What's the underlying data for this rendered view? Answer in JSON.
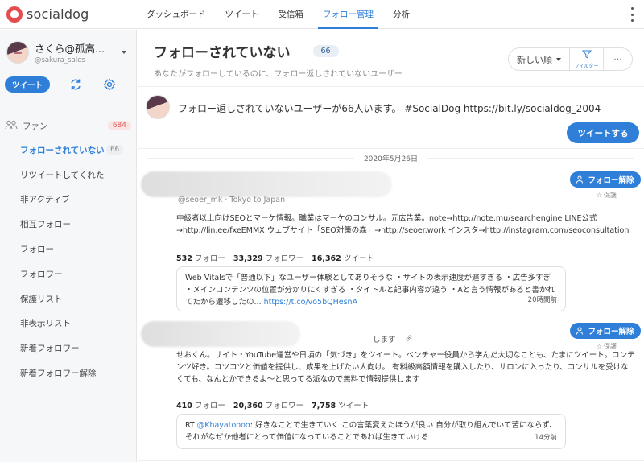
{
  "app": {
    "logo_text": "socialdog"
  },
  "nav": {
    "items": [
      {
        "label": "ダッシュボード"
      },
      {
        "label": "ツイート"
      },
      {
        "label": "受信箱"
      },
      {
        "label": "フォロー管理"
      },
      {
        "label": "分析"
      }
    ],
    "active": "フォロー管理"
  },
  "account": {
    "name": "さくら@孤高...",
    "handle": "@sakura_sales"
  },
  "sidebar": {
    "tweet_button": "ツイート",
    "fan": {
      "label": "ファン",
      "count": "684"
    },
    "items": [
      {
        "label": "フォローされていない",
        "count": "66"
      },
      {
        "label": "リツイートしてくれた"
      },
      {
        "label": "非アクティブ"
      },
      {
        "label": "相互フォロー"
      },
      {
        "label": "フォロー"
      },
      {
        "label": "フォロワー"
      },
      {
        "label": "保護リスト"
      },
      {
        "label": "非表示リスト"
      },
      {
        "label": "新着フォロワー"
      },
      {
        "label": "新着フォロワー解除"
      }
    ]
  },
  "header": {
    "title": "フォローされていない",
    "count": "66",
    "subtitle": "あなたがフォローしているのに、フォロー返しされていないユーザー",
    "sort_label": "新しい順",
    "filter_label": "フィルター",
    "more_label": "···"
  },
  "share": {
    "text": "フォロー返しされていないユーザーが66人います。 #SocialDog https://bit.ly/socialdog_2004",
    "button": "ツイートする"
  },
  "date_separator": "2020年5月26日",
  "users": [
    {
      "handle_line": "@seoer_mk · Tokyo to Japan",
      "unfollow_label": "フォロー解除",
      "protect_label": "保護",
      "bio": "中級者以上向けSEOとマーケ情報。職業はマーケのコンサル。元広告業。note→http://note.mu/searchengine LINE公式→http://lin.ee/fxeEMMX ウェブサイト「SEO対策の森」→http://seoer.work インスタ→http://instagram.com/seoconsultation",
      "stats": {
        "follow": "532",
        "follow_label": "フォロー",
        "followers": "33,329",
        "followers_label": "フォロワー",
        "tweets": "16,362",
        "tweets_label": "ツイート"
      },
      "tweet": {
        "text": "Web Vitalsで「普通以下」なユーザー体験としてありそうな ・サイトの表示速度が遅すぎる ・広告多すぎ ・メインコンテンツの位置が分かりにくすぎる ・タイトルと記事内容が違う ・Aと言う情報があると書かれてたから遷移したの...",
        "link": "https://t.co/vo5bQHesnA",
        "time": "20時間前"
      }
    },
    {
      "handle_line": "します",
      "unfollow_label": "フォロー解除",
      "protect_label": "保護",
      "bio": "せおくん。サイト・YouTube運営や日頃の「気づき」をツイート。ベンチャー役員から学んだ大切なことも、たまにツイート。コンテンツ好き。コツコツと価値を提供し、成果を上げたい人向け。 有料級高額情報を購入したり、サロンに入ったり、コンサルを受けなくても、なんとかできるよ〜と思ってる派なので無料で情報提供します",
      "stats": {
        "follow": "410",
        "follow_label": "フォロー",
        "followers": "20,360",
        "followers_label": "フォロワー",
        "tweets": "7,758",
        "tweets_label": "ツイート"
      },
      "tweet": {
        "prefix": "RT ",
        "mention": "@Khayatoooo",
        "text": ": 好きなことで生きていく この言葉変えたほうが良い 自分が取り組んでいて苦にならず、それがなぜか他者にとって価値になっていることであれば生きていける",
        "time": "14分前"
      }
    }
  ]
}
